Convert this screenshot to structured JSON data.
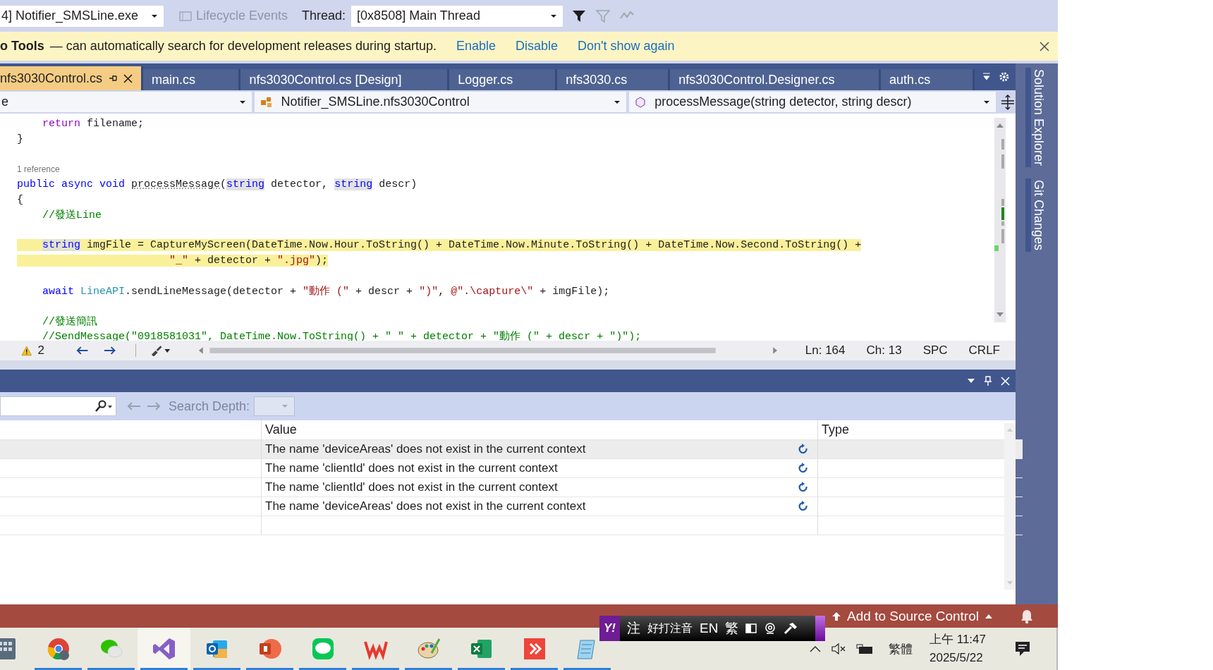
{
  "toolbar": {
    "process": "4] Notifier_SMSLine.exe",
    "lifecycle": "Lifecycle Events",
    "thread_label": "Thread:",
    "thread": "[0x8508] Main Thread"
  },
  "infobar": {
    "title": "o Tools",
    "message": "— can automatically search for development releases during startup.",
    "links": [
      "Enable",
      "Disable",
      "Don't show again"
    ]
  },
  "tabs": [
    {
      "label": "nfs3030Control.cs",
      "selected": true
    },
    {
      "label": "main.cs",
      "selected": false
    },
    {
      "label": "nfs3030Control.cs [Design]",
      "selected": false
    },
    {
      "label": "Logger.cs",
      "selected": false
    },
    {
      "label": "nfs3030.cs",
      "selected": false
    },
    {
      "label": "nfs3030Control.Designer.cs",
      "selected": false
    },
    {
      "label": "auth.cs",
      "selected": false
    }
  ],
  "navbar": {
    "project": "e",
    "type": "Notifier_SMSLine.nfs3030Control",
    "member": "processMessage(string detector, string descr)"
  },
  "code": [
    {
      "kind": "code",
      "highlighted": false,
      "tokens": [
        {
          "kind": "control",
          "text": "    return"
        },
        {
          "kind": "plain",
          "text": " filename;"
        }
      ]
    },
    {
      "kind": "code",
      "highlighted": false,
      "tokens": [
        {
          "kind": "plain",
          "text": "}"
        }
      ]
    },
    {
      "kind": "blank"
    },
    {
      "kind": "codelens",
      "text": "1 reference"
    },
    {
      "kind": "code",
      "highlighted": false,
      "tokens": [
        {
          "kind": "keyword",
          "text": "public async void "
        },
        {
          "kind": "method",
          "text": "processMessage"
        },
        {
          "kind": "plain",
          "text": "("
        },
        {
          "kind": "keyword_ref",
          "text": "string"
        },
        {
          "kind": "plain",
          "text": " detector, "
        },
        {
          "kind": "keyword_ref",
          "text": "string"
        },
        {
          "kind": "plain",
          "text": " descr)"
        }
      ]
    },
    {
      "kind": "code",
      "highlighted": false,
      "tokens": [
        {
          "kind": "plain",
          "text": "{"
        }
      ]
    },
    {
      "kind": "code",
      "highlighted": false,
      "tokens": [
        {
          "kind": "comment",
          "text": "    //發送Line"
        }
      ]
    },
    {
      "kind": "blank"
    },
    {
      "kind": "code",
      "highlighted": true,
      "tokens": [
        {
          "kind": "keyword_ref",
          "text": "    string"
        },
        {
          "kind": "plain",
          "text": " imgFile = CaptureMyScreen(DateTime.Now.Hour.ToString() + DateTime.Now.Minute.ToString() + DateTime.Now.Second.ToString() +"
        }
      ]
    },
    {
      "kind": "code",
      "highlighted": true,
      "tokens": [
        {
          "kind": "string",
          "text": "                        \"_\""
        },
        {
          "kind": "plain",
          "text": " + detector + "
        },
        {
          "kind": "string",
          "text": "\".jpg\""
        },
        {
          "kind": "plain",
          "text": ");"
        }
      ]
    },
    {
      "kind": "blank"
    },
    {
      "kind": "code",
      "highlighted": false,
      "tokens": [
        {
          "kind": "keyword",
          "text": "    await"
        },
        {
          "kind": "type",
          "text": " LineAPI"
        },
        {
          "kind": "plain",
          "text": ".sendLineMessage(detector + "
        },
        {
          "kind": "string",
          "text": "\"動作 (\""
        },
        {
          "kind": "plain",
          "text": " + descr + "
        },
        {
          "kind": "string",
          "text": "\")\""
        },
        {
          "kind": "plain",
          "text": ", "
        },
        {
          "kind": "string",
          "text": "@\".\\capture\\\""
        },
        {
          "kind": "plain",
          "text": " + imgFile);"
        }
      ]
    },
    {
      "kind": "blank"
    },
    {
      "kind": "code",
      "highlighted": false,
      "tokens": [
        {
          "kind": "comment",
          "text": "    //發送簡訊"
        }
      ]
    },
    {
      "kind": "code",
      "highlighted": false,
      "tokens": [
        {
          "kind": "comment",
          "text": "    //SendMessage(\"0918581031\", DateTime.Now.ToString() + \" \" + detector + \"動作 (\" + descr + \")\");"
        }
      ]
    }
  ],
  "editor_status": {
    "warnings": "2",
    "line": "Ln: 164",
    "column": "Ch: 13",
    "whitespace": "SPC",
    "line_endings": "CRLF"
  },
  "side_tabs": [
    "Solution Explorer",
    "Git Changes"
  ],
  "watch": {
    "search_depth_label": "Search Depth:",
    "columns": [
      "Value",
      "Type"
    ],
    "rows": [
      {
        "value": "The name 'deviceAreas' does not exist in the current context",
        "selected": true
      },
      {
        "value": "The name 'clientId' does not exist in the current context",
        "selected": false
      },
      {
        "value": "The name 'clientId' does not exist in the current context",
        "selected": false
      },
      {
        "value": "The name 'deviceAreas' does not exist in the current context",
        "selected": false
      }
    ]
  },
  "status_bar": {
    "text": "Add to Source Control"
  },
  "ime": {
    "logo": "Y!",
    "mode": "注",
    "name": "好打注音",
    "lang": "EN",
    "script": "繁"
  },
  "taskbar": {
    "apps": [
      {
        "kind": "calculator",
        "selected": false,
        "running": false
      },
      {
        "kind": "chrome",
        "selected": false,
        "running": true
      },
      {
        "kind": "wechat",
        "selected": false,
        "running": true
      },
      {
        "kind": "visualstudio",
        "selected": true,
        "running": true
      },
      {
        "kind": "outlook",
        "selected": false,
        "running": true
      },
      {
        "kind": "powerpoint",
        "selected": false,
        "running": true
      },
      {
        "kind": "line",
        "selected": false,
        "running": true
      },
      {
        "kind": "wps",
        "selected": false,
        "running": true
      },
      {
        "kind": "paint",
        "selected": false,
        "running": true
      },
      {
        "kind": "excel",
        "selected": false,
        "running": true
      },
      {
        "kind": "anydesk",
        "selected": false,
        "running": true
      },
      {
        "kind": "notepad",
        "selected": false,
        "running": true
      }
    ],
    "tray_language": "繁體",
    "time": "上午 11:47",
    "date": "2025/5/22"
  }
}
